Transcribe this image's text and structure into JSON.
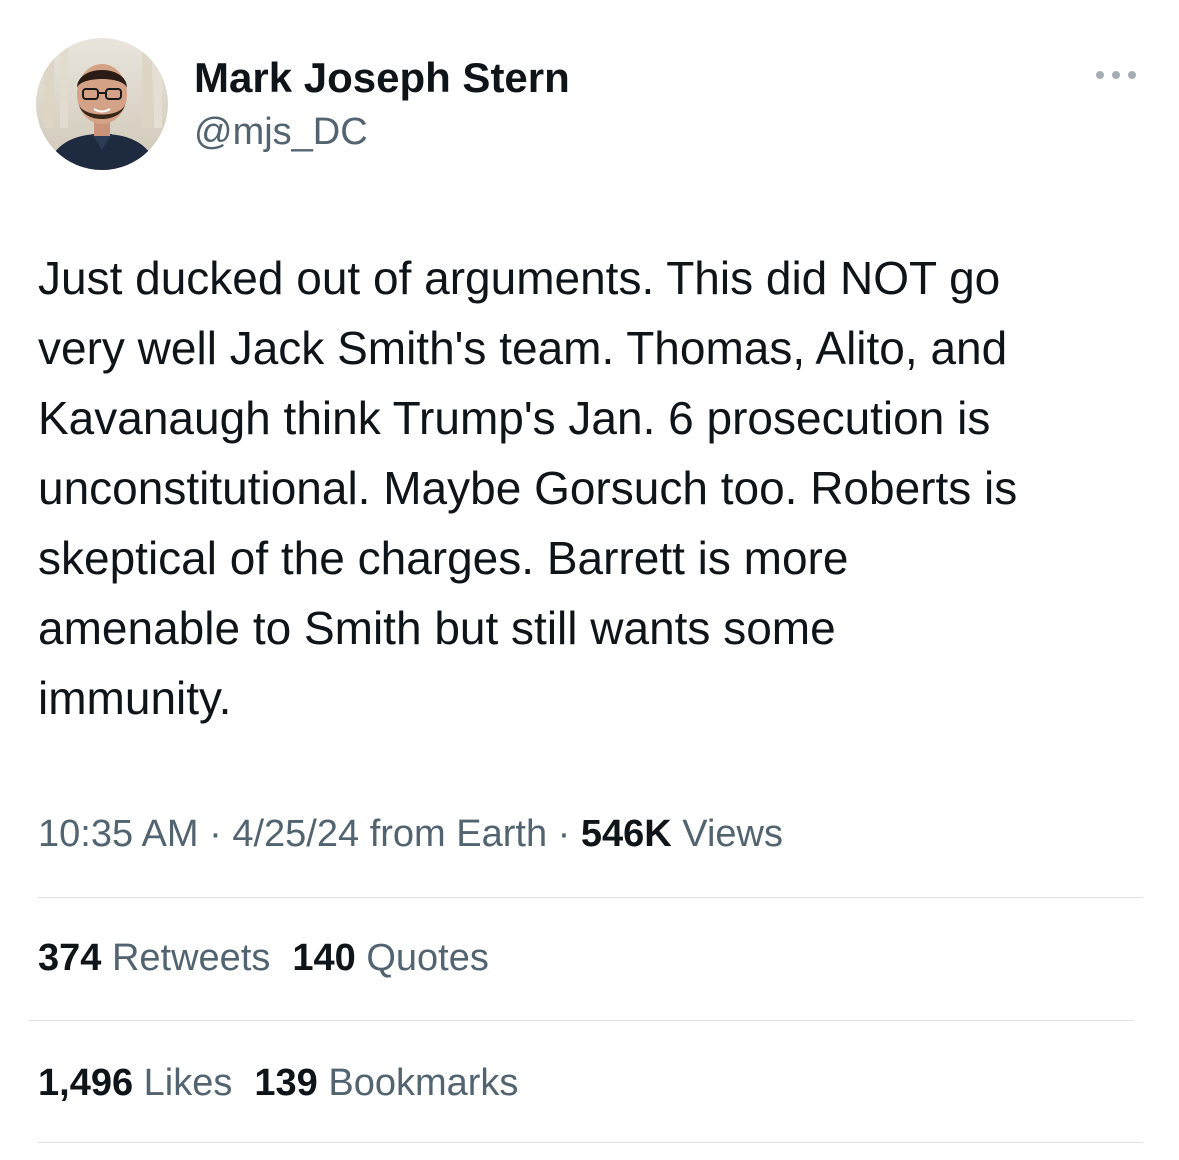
{
  "author": {
    "display_name": "Mark Joseph Stern",
    "handle": "@mjs_DC",
    "avatar_icon": "profile-photo"
  },
  "more_icon": "more-horizontal-icon",
  "tweet": {
    "text": "Just ducked out of arguments. This did NOT go\nvery well Jack Smith's team. Thomas, Alito, and\nKavanaugh think Trump's Jan. 6 prosecution is\nunconstitutional. Maybe Gorsuch too. Roberts is\nskeptical of the charges. Barrett is more\namenable to Smith but still wants some\nimmunity."
  },
  "meta": {
    "time": "10:35 AM",
    "separator": " · ",
    "date": "4/25/24",
    "source": "from Earth",
    "views_count": "546K",
    "views_label": "Views"
  },
  "stats": {
    "retweets_count": "374",
    "retweets_label": "Retweets",
    "quotes_count": "140",
    "quotes_label": "Quotes",
    "likes_count": "1,496",
    "likes_label": "Likes",
    "bookmarks_count": "139",
    "bookmarks_label": "Bookmarks"
  },
  "colors": {
    "text_primary": "#0f1419",
    "text_secondary": "#536471",
    "divider": "#dfe3e6"
  }
}
